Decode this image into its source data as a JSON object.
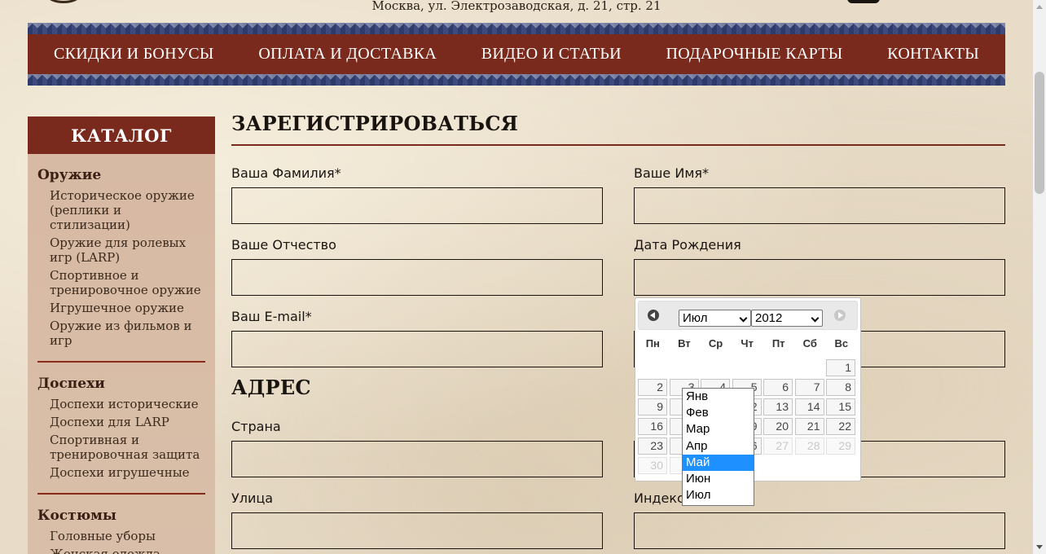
{
  "header": {
    "address": "Москва, ул. Электрозаводская, д. 21, стр. 21"
  },
  "nav": {
    "items": [
      {
        "label": "СКИДКИ И БОНУСЫ"
      },
      {
        "label": "ОПЛАТА И ДОСТАВКА"
      },
      {
        "label": "ВИДЕО И СТАТЬИ"
      },
      {
        "label": "ПОДАРОЧНЫЕ КАРТЫ"
      },
      {
        "label": "КОНТАКТЫ"
      }
    ]
  },
  "sidebar": {
    "title": "КАТАЛОГ",
    "sections": [
      {
        "heading": "Оружие",
        "links": [
          "Историческое оружие (реплики и стилизации)",
          "Оружие для ролевых игр (LARP)",
          "Спортивное и тренировочное оружие",
          "Игрушечное оружие",
          "Оружие из фильмов и игр"
        ]
      },
      {
        "heading": "Доспехи",
        "links": [
          "Доспехи исторические",
          "Доспехи для LARP",
          "Спортивная и тренировочная защита",
          "Доспехи игрушечные"
        ]
      },
      {
        "heading": "Костюмы",
        "links": [
          "Головные уборы",
          "Женская одежда"
        ]
      }
    ]
  },
  "form": {
    "title": "ЗАРЕГИСТРИРОВАТЬСЯ",
    "lastname_label": "Ваша Фамилия*",
    "firstname_label": "Ваше Имя*",
    "middlename_label": "Ваше Отчество",
    "birthdate_label": "Дата Рождения",
    "email_label": "Ваш E-mail*",
    "address_title": "АДРЕС",
    "country_label": "Страна",
    "street_label": "Улица",
    "index_label": "Индекс"
  },
  "datepicker": {
    "month": "Июл",
    "year": "2012",
    "weekdays": [
      "Пн",
      "Вт",
      "Ср",
      "Чт",
      "Пт",
      "Сб",
      "Вс"
    ],
    "month_options": [
      "Янв",
      "Фев",
      "Мар",
      "Апр",
      "Май",
      "Июн",
      "Июл"
    ],
    "highlighted_option": "Май"
  }
}
